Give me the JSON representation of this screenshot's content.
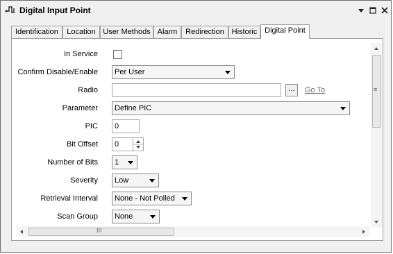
{
  "window": {
    "title": "Digital Input Point",
    "icon": "digital-signal-icon",
    "controls": [
      "dropdown-icon",
      "maximize-icon",
      "close-icon"
    ]
  },
  "tabs": [
    {
      "label": "Identification"
    },
    {
      "label": "Location"
    },
    {
      "label": "User Methods"
    },
    {
      "label": "Alarm"
    },
    {
      "label": "Redirection"
    },
    {
      "label": "Historic"
    },
    {
      "label": "Digital Point",
      "active": true
    }
  ],
  "form": {
    "in_service": {
      "label": "In Service",
      "checked": false
    },
    "confirm": {
      "label": "Confirm Disable/Enable",
      "value": "Per User"
    },
    "radio": {
      "label": "Radio",
      "value": "",
      "browse": "...",
      "goto": "Go To"
    },
    "parameter": {
      "label": "Parameter",
      "value": "Define PIC"
    },
    "pic": {
      "label": "PIC",
      "value": "0"
    },
    "bit_offset": {
      "label": "Bit Offset",
      "value": "0"
    },
    "number_of_bits": {
      "label": "Number of Bits",
      "value": "1"
    },
    "severity": {
      "label": "Severity",
      "value": "Low"
    },
    "retrieval_interval": {
      "label": "Retrieval Interval",
      "value": "None - Not Polled"
    },
    "scan_group": {
      "label": "Scan Group",
      "value": "None"
    }
  },
  "scrollbars": {
    "horizontal_thumb_glyph": "III",
    "vertical_thumb_glyph": "≡"
  }
}
